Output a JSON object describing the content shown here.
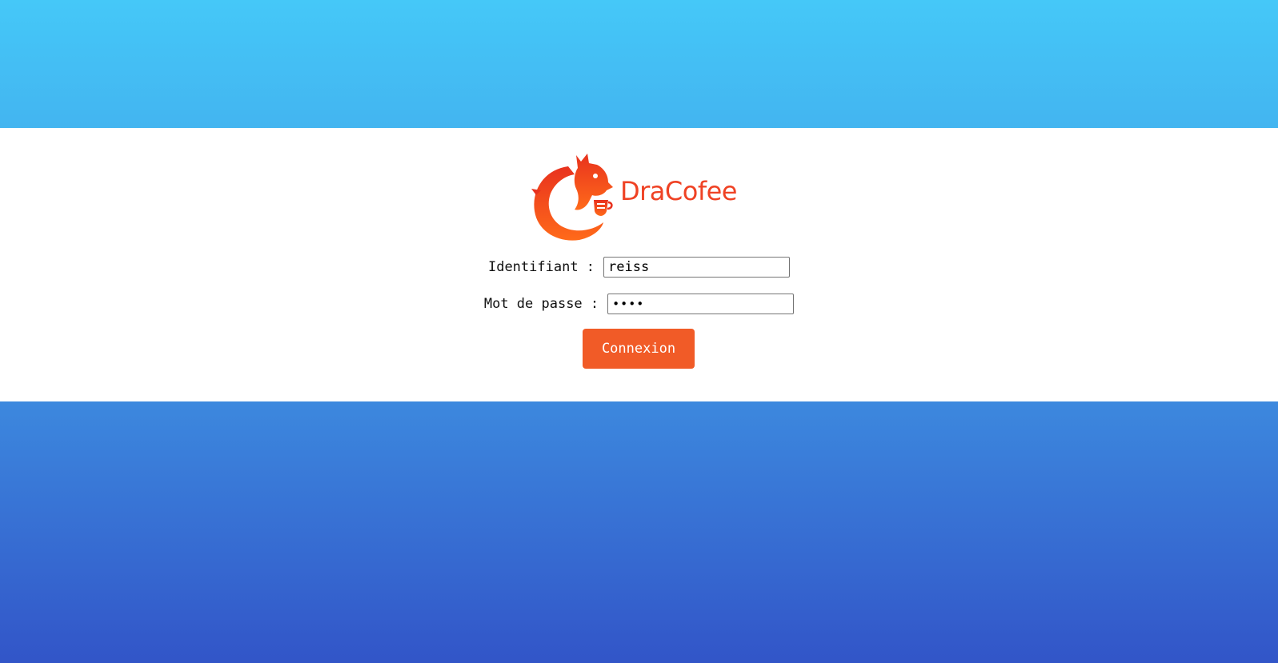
{
  "brand": {
    "name": "DraCofee",
    "logo_icon": "dragon-coffee-logo",
    "color": "#ef4224"
  },
  "login_form": {
    "username_label": "Identifiant :",
    "username_value": "reiss",
    "password_label": "Mot de passe :",
    "password_value": "••••",
    "submit_label": "Connexion"
  },
  "colors": {
    "button": "#f15b27",
    "gradient_top": "#45c8f8",
    "gradient_bottom": "#3255c8",
    "panel": "#ffffff"
  }
}
